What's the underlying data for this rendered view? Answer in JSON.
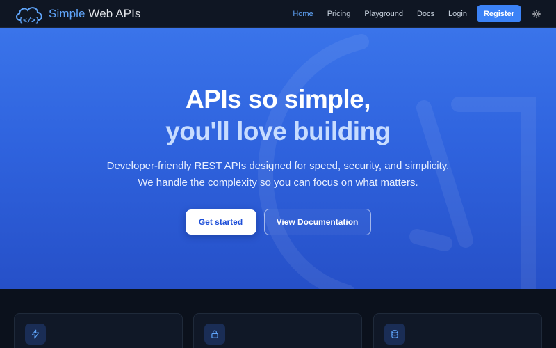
{
  "brand": {
    "name_part1": "Simple",
    "name_part2": " Web APIs",
    "logo_icon": "cloud-code-icon"
  },
  "nav": {
    "items": [
      {
        "label": "Home",
        "active": true
      },
      {
        "label": "Pricing",
        "active": false
      },
      {
        "label": "Playground",
        "active": false
      },
      {
        "label": "Docs",
        "active": false
      },
      {
        "label": "Login",
        "active": false
      }
    ],
    "register_label": "Register",
    "theme_icon": "sun-icon"
  },
  "hero": {
    "title_line1": "APIs so simple,",
    "title_line2": "you'll love building",
    "subtitle_line1": "Developer-friendly REST APIs designed for speed, security, and simplicity.",
    "subtitle_line2": "We handle the complexity so you can focus on what matters.",
    "primary_cta": "Get started",
    "secondary_cta": "View Documentation"
  },
  "features": {
    "cards": [
      {
        "icon": "lightning-icon"
      },
      {
        "icon": "lock-icon"
      },
      {
        "icon": "database-icon"
      }
    ]
  },
  "colors": {
    "accent": "#3b82f6",
    "accent_light": "#60a5fa",
    "hero_start": "#3a74ea",
    "hero_end": "#2650c8",
    "nav_bg": "#0f1623",
    "dark_bg": "#0b111c"
  }
}
